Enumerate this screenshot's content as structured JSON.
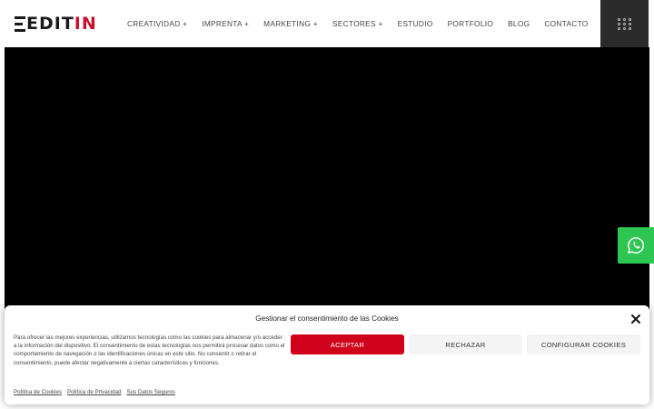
{
  "logo": {
    "dark": "EDIT",
    "red": "IN"
  },
  "nav": [
    {
      "label": "CREATIVIDAD +"
    },
    {
      "label": "IMPRENTA +"
    },
    {
      "label": "MARKETING +"
    },
    {
      "label": "SECTORES +"
    },
    {
      "label": "ESTUDIO"
    },
    {
      "label": "PORTFOLIO"
    },
    {
      "label": "BLOG"
    },
    {
      "label": "CONTACTO"
    }
  ],
  "colors": {
    "brand_red": "#c8102e",
    "accept_red": "#d0021b",
    "whatsapp_green": "#2ec653",
    "menu_dark": "#2b2b2b"
  },
  "icons": {
    "menu": "grid-dots-icon",
    "whatsapp": "whatsapp-icon",
    "close": "close-icon"
  },
  "cookie": {
    "title": "Gestionar el consentimiento de las Cookies",
    "message": "Para ofrecer las mejores experiencias, utilizamos tecnologías como las cookies para almacenar y/o acceder a la información del dispositivo. El consentimiento de estas tecnologías nos permitirá procesar datos como el comportamiento de navegación o las identificaciones únicas en este sitio. No consentir o retirar el consentimiento, puede afectar negativamente a ciertas características y funciones.",
    "accept": "ACEPTAR",
    "reject": "RECHAZAR",
    "configure": "CONFIGURAR COOKIES",
    "links": [
      "Política de Cookies",
      "Política de Privacidad",
      "Sus Datos Seguros"
    ]
  }
}
